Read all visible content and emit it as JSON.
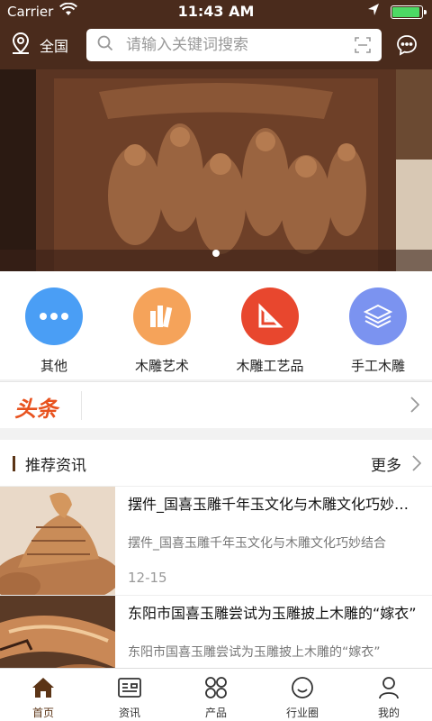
{
  "status": {
    "carrier": "Carrier",
    "time": "11:43 AM"
  },
  "header": {
    "location": "全国",
    "search_placeholder": "请输入关键词搜索"
  },
  "categories": [
    {
      "label": "其他",
      "icon": "more-dots-icon",
      "color": "#4a9ef5"
    },
    {
      "label": "木雕艺术",
      "icon": "books-icon",
      "color": "#f5a35a"
    },
    {
      "label": "木雕工艺品",
      "icon": "triangle-ruler-icon",
      "color": "#e8472e"
    },
    {
      "label": "手工木雕",
      "icon": "layers-icon",
      "color": "#7b93f0"
    }
  ],
  "headline": {
    "tag": "头条"
  },
  "recommend": {
    "title": "推荐资讯",
    "more": "更多",
    "items": [
      {
        "title": "摆件_国喜玉雕千年玉文化与木雕文化巧妙结合",
        "desc": "摆件_国喜玉雕千年玉文化与木雕文化巧妙结合",
        "date": "12-15"
      },
      {
        "title": "东阳市国喜玉雕尝试为玉雕披上木雕的“嫁衣”",
        "desc": "东阳市国喜玉雕尝试为玉雕披上木雕的“嫁衣”",
        "date": ""
      }
    ]
  },
  "tabs": [
    {
      "label": "首页",
      "icon": "home-icon",
      "active": true
    },
    {
      "label": "资讯",
      "icon": "news-icon",
      "active": false
    },
    {
      "label": "产品",
      "icon": "grid-icon",
      "active": false
    },
    {
      "label": "行业圈",
      "icon": "smile-icon",
      "active": false
    },
    {
      "label": "我的",
      "icon": "person-icon",
      "active": false
    }
  ],
  "colors": {
    "brand": "#4a2b1c",
    "accent": "#e8521e"
  }
}
